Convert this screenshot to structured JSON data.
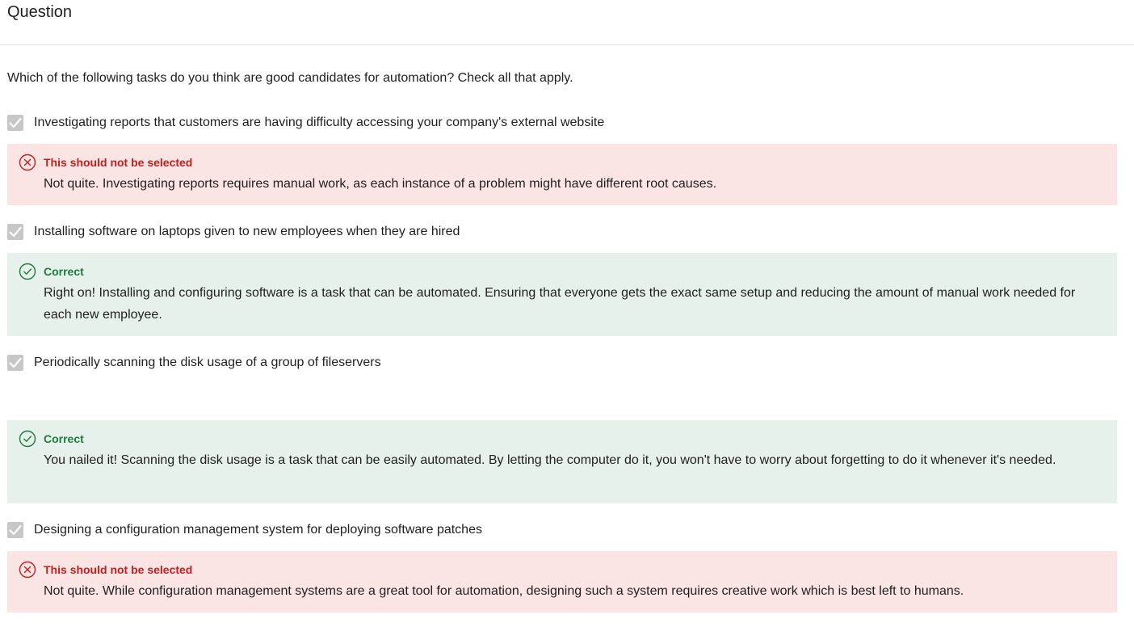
{
  "header": {
    "title": "Question"
  },
  "question": {
    "prompt": "Which of the following tasks do you think are good candidates for automation? Check all that apply."
  },
  "options": [
    {
      "label": "Investigating reports that customers are having difficulty accessing your company's external website",
      "checked": true,
      "feedback_type": "incorrect",
      "feedback_status": "This should not be selected",
      "feedback_text": "Not quite. Investigating reports requires manual work, as each instance of a problem might have different root causes."
    },
    {
      "label": "Installing software on laptops given to new employees when they are hired",
      "checked": true,
      "feedback_type": "correct",
      "feedback_status": "Correct",
      "feedback_text": "Right on! Installing and configuring software is a task that can be automated. Ensuring that everyone gets the exact same setup and reducing the amount of manual work needed for each new employee."
    },
    {
      "label": "Periodically scanning the disk usage of a group of fileservers",
      "checked": true,
      "feedback_type": "correct",
      "feedback_status": "Correct",
      "feedback_text": "You nailed it! Scanning the disk usage is a task that can be easily automated. By letting the computer do it, you won't have to worry about forgetting to do it whenever it's needed."
    },
    {
      "label": "Designing a configuration management system for deploying software patches",
      "checked": true,
      "feedback_type": "incorrect",
      "feedback_status": "This should not be selected",
      "feedback_text": "Not quite. While configuration management systems are a great tool for automation, designing such a system requires creative work which is best left to humans."
    }
  ],
  "colors": {
    "incorrect_bg": "#fbe5e4",
    "incorrect_accent": "#c21e1e",
    "correct_bg": "#e7f1ec",
    "correct_accent": "#1e7a3e",
    "checkbox_fill": "#c7c7c7"
  },
  "icons": {
    "checkbox": "check-icon",
    "incorrect": "x-circle-icon",
    "correct": "check-circle-icon"
  }
}
